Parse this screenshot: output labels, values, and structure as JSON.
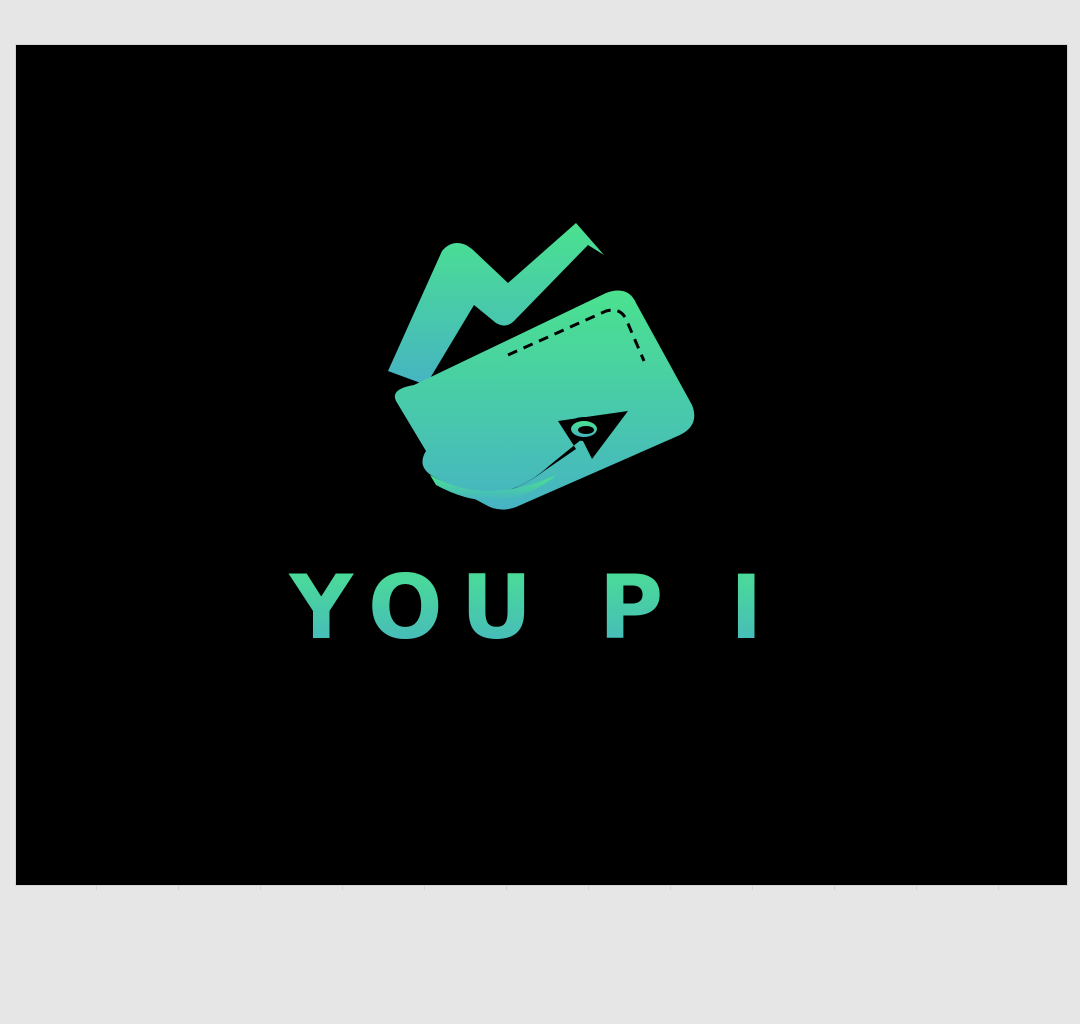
{
  "brand": {
    "wordmark": "YOU P I",
    "gradient_top": "#4be28f",
    "gradient_bottom": "#46b4c2",
    "background": "#000000"
  },
  "icons": {
    "logo": "wallet-with-rising-arrow-icon"
  }
}
